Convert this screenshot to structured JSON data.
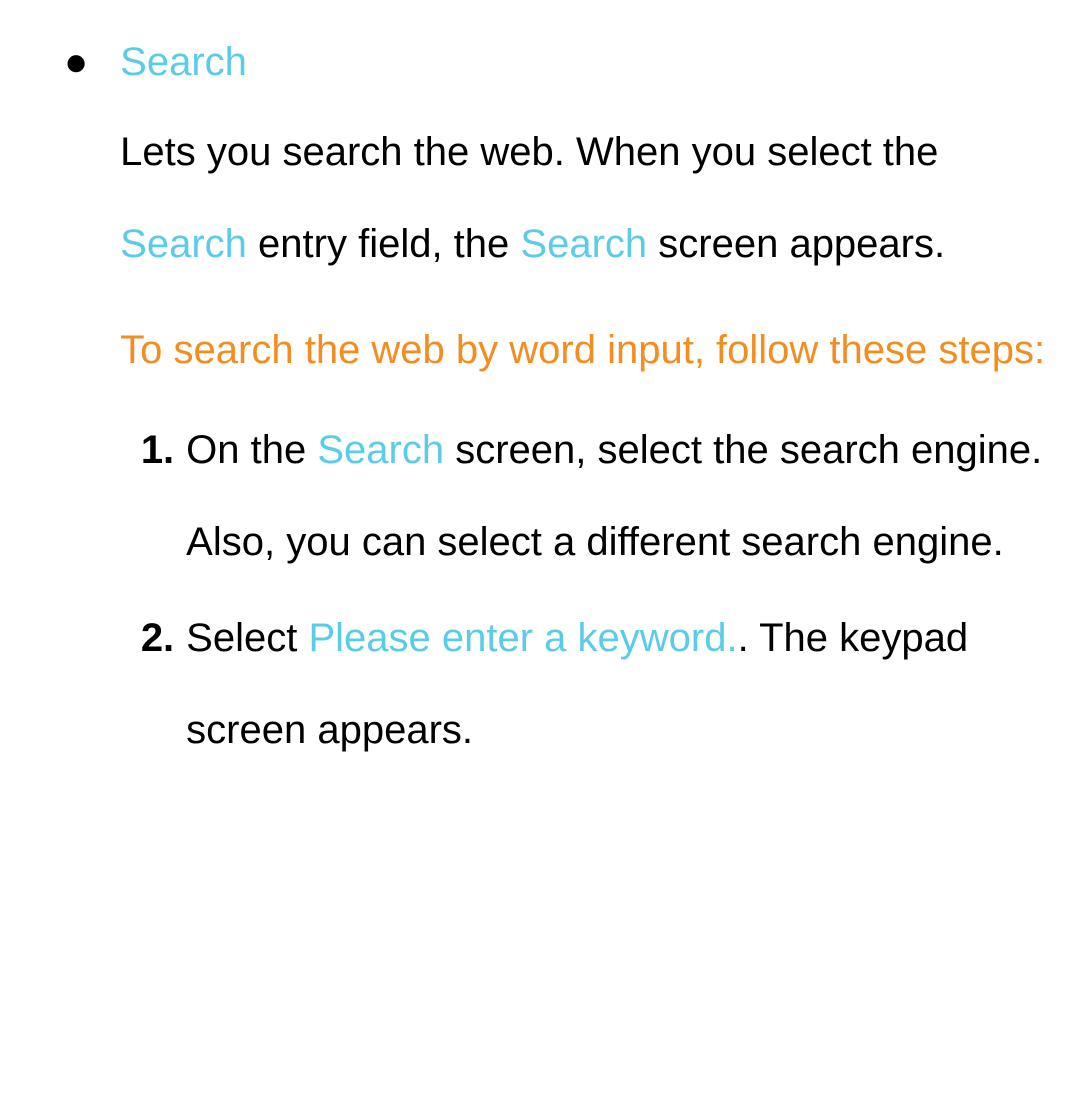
{
  "item": {
    "heading": "Search",
    "intro": {
      "before": "Lets you search the web. When you select the ",
      "cyan1": "Search",
      "mid": " entry field, the ",
      "cyan2": "Search",
      "after": " screen appears."
    },
    "instructions_title": "To search the web by word input, follow these steps:",
    "steps": [
      {
        "num": "1.",
        "before": "On the ",
        "cyan": "Search",
        "after": " screen, select the search engine. Also, you can select a different search engine."
      },
      {
        "num": "2.",
        "before": "Select ",
        "cyan": "Please enter a keyword.",
        "after": ". The keypad screen appears."
      }
    ]
  }
}
